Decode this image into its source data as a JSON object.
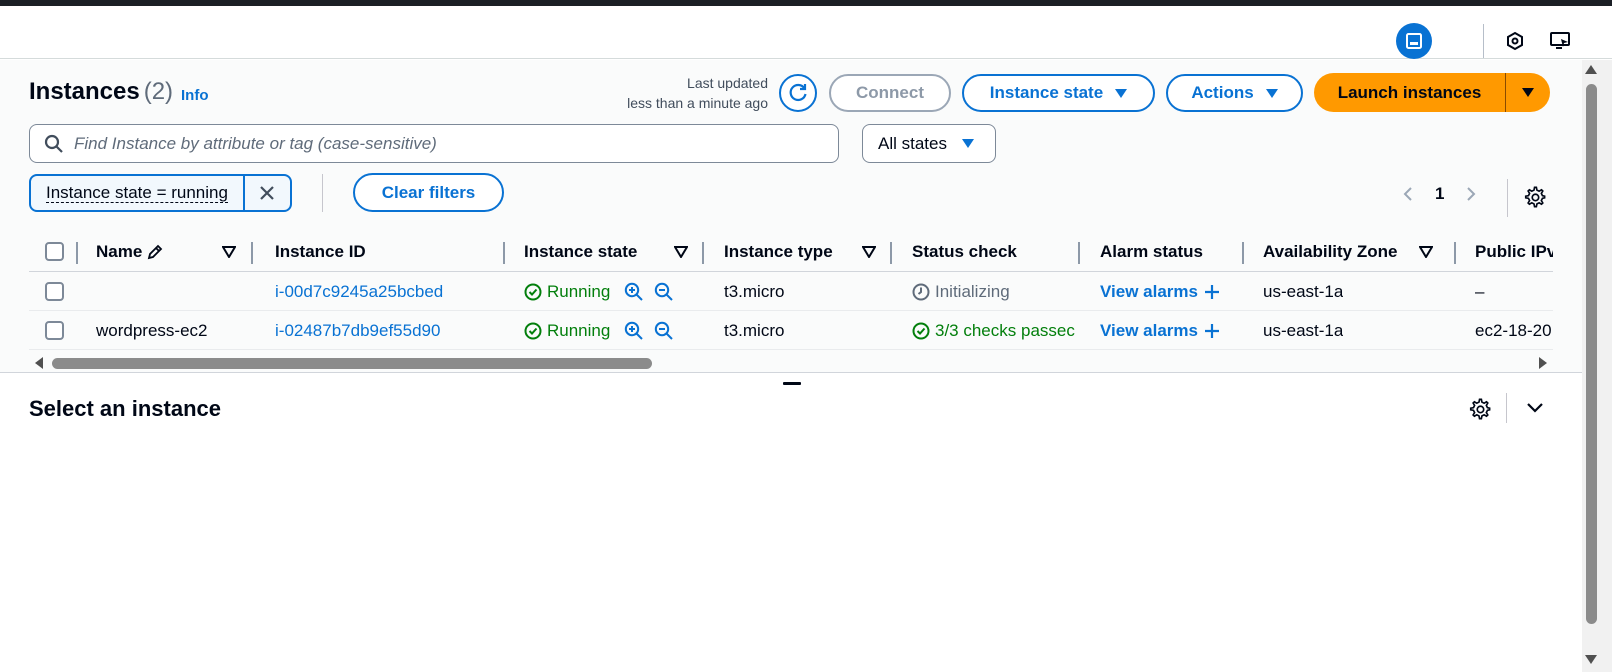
{
  "header": {
    "title": "Instances",
    "count": "(2)",
    "info": "Info",
    "last_updated_line1": "Last updated",
    "last_updated_line2": "less than a minute ago"
  },
  "toolbar": {
    "connect": "Connect",
    "instance_state": "Instance state",
    "actions": "Actions",
    "launch": "Launch instances"
  },
  "search": {
    "placeholder": "Find Instance by attribute or tag (case-sensitive)",
    "states_select": "All states"
  },
  "filters": {
    "token": "Instance state = running",
    "clear": "Clear filters"
  },
  "pagination": {
    "current_page": "1"
  },
  "table": {
    "columns": [
      "Name",
      "Instance ID",
      "Instance state",
      "Instance type",
      "Status check",
      "Alarm status",
      "Availability Zone",
      "Public IPv"
    ],
    "rows": [
      {
        "name": "",
        "instance_id": "i-00d7c9245a25bcbed",
        "state": "Running",
        "type": "t3.micro",
        "status_check": "Initializing",
        "alarm": "View alarms",
        "az": "us-east-1a",
        "public_ip": "–"
      },
      {
        "name": "wordpress-ec2",
        "instance_id": "i-02487b7db9ef55d90",
        "state": "Running",
        "type": "t3.micro",
        "status_check": "3/3 checks passec",
        "alarm": "View alarms",
        "az": "us-east-1a",
        "public_ip": "ec2-18-20"
      }
    ]
  },
  "detail": {
    "title": "Select an instance"
  },
  "colors": {
    "accent": "#0972d3",
    "launch": "#ff9900",
    "success": "#037f0c",
    "text": "#000716"
  }
}
